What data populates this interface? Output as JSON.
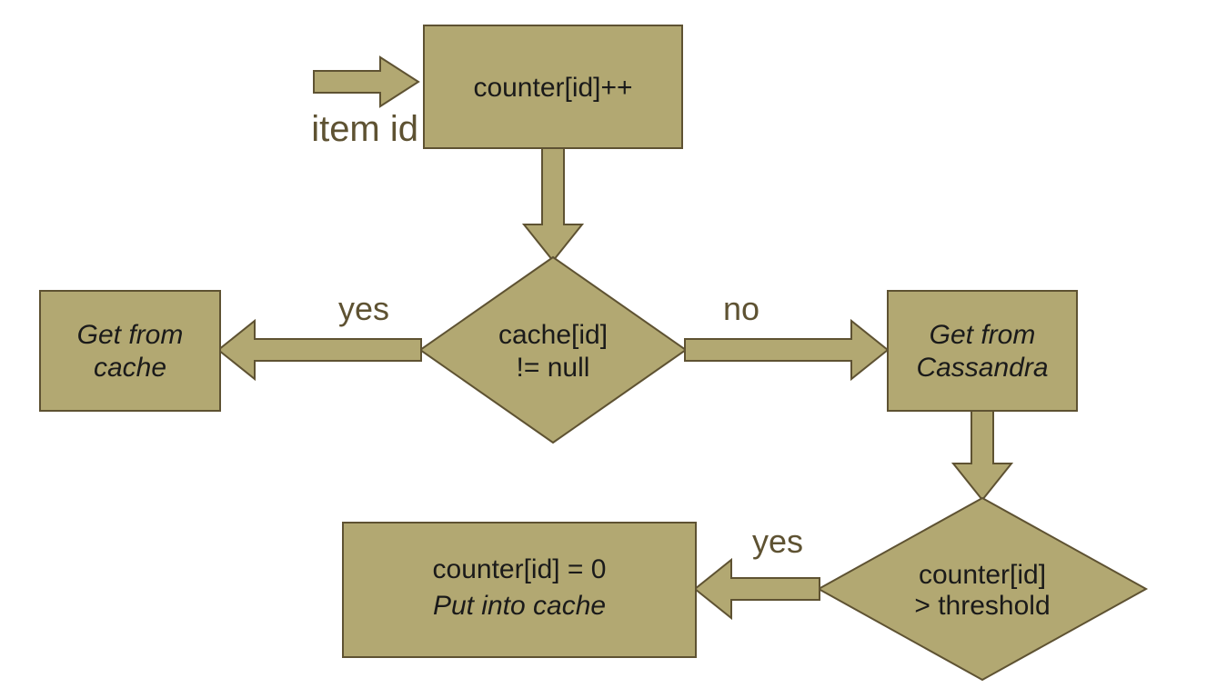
{
  "diagram": {
    "input_label": "item id",
    "nodes": {
      "counter_inc": {
        "text": "counter[id]++"
      },
      "cache_check": {
        "line1": "cache[id]",
        "line2": "!= null"
      },
      "get_cache": {
        "line1": "Get from",
        "line2": "cache"
      },
      "get_cassandra": {
        "line1": "Get from",
        "line2": "Cassandra"
      },
      "threshold_check": {
        "line1": "counter[id]",
        "line2": "> threshold"
      },
      "put_cache": {
        "line1": "counter[id] = 0",
        "line2": "Put into cache"
      }
    },
    "edges": {
      "cache_yes": "yes",
      "cache_no": "no",
      "threshold_yes": "yes"
    }
  }
}
